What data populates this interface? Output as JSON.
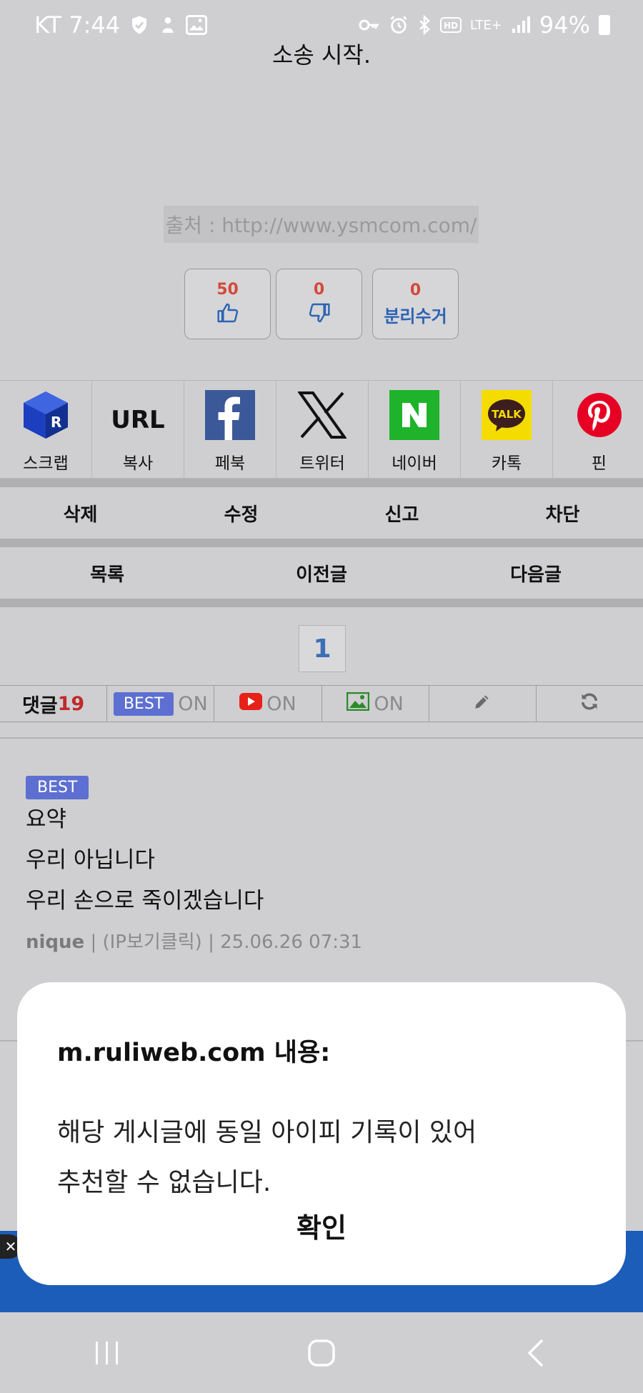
{
  "status": {
    "carrier_time": "KT 7:44",
    "network": "LTE+",
    "battery": "94%"
  },
  "post": {
    "end_text": "소송 시작.",
    "source": "출처 : http://www.ysmcom.com/"
  },
  "votes": [
    {
      "count": "50",
      "icon": "thumbs-up-icon"
    },
    {
      "count": "0",
      "icon": "thumbs-down-icon"
    },
    {
      "count": "0",
      "label": "분리수거"
    }
  ],
  "share": [
    {
      "label": "스크랩",
      "icon": "scrap-icon"
    },
    {
      "label": "복사",
      "text": "URL",
      "icon": "url-icon"
    },
    {
      "label": "페북",
      "icon": "facebook-icon"
    },
    {
      "label": "트위터",
      "icon": "x-icon"
    },
    {
      "label": "네이버",
      "icon": "naver-icon"
    },
    {
      "label": "카톡",
      "text": "TALK",
      "icon": "kakaotalk-icon"
    },
    {
      "label": "핀",
      "icon": "pinterest-icon"
    }
  ],
  "menu1": [
    "삭제",
    "수정",
    "신고",
    "차단"
  ],
  "menu2": [
    "목록",
    "이전글",
    "다음글"
  ],
  "page": "1",
  "comment_bar": {
    "label": "댓글",
    "count": "19",
    "best": "BEST",
    "on": "ON"
  },
  "comment": {
    "badge": "BEST",
    "lines": [
      "요약",
      "우리 아닙니다",
      "우리 손으로 죽이겠습니다"
    ],
    "author": "nique",
    "ip": "(IP보기클릭)",
    "date": "25.06.26 07:31",
    "sep": "|"
  },
  "dialog": {
    "title": "m.ruliweb.com 내용:",
    "line1": "해당 게시글에 동일 아이피 기록이 있어",
    "line2": "추천할 수 없습니다.",
    "ok": "확인"
  },
  "ad_close": "✕",
  "colors": {
    "accent_blue": "#1b5db8",
    "best_badge": "#5d6fd0",
    "count_red": "#c02a2a"
  }
}
